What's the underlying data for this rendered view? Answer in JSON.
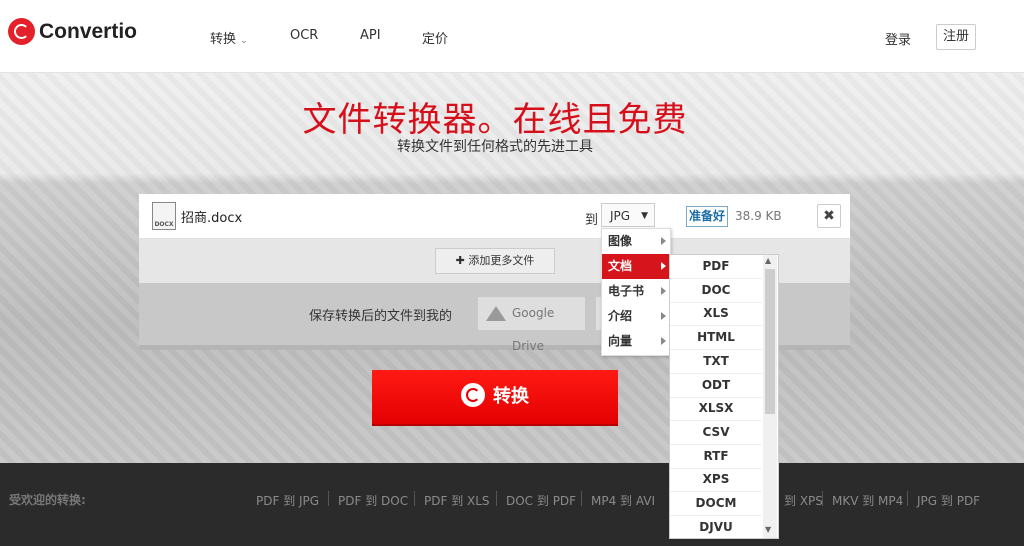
{
  "header": {
    "logo_text": "Convertio",
    "nav": [
      "转换",
      "OCR",
      "API",
      "定价"
    ],
    "login": "登录",
    "register": "注册"
  },
  "hero": {
    "title": "文件转换器。在线且免费",
    "subtitle": "转换文件到任何格式的先进工具"
  },
  "file": {
    "icon_label": "DOCX",
    "name": "招商.docx",
    "to_label": "到",
    "selected_format": "JPG",
    "status": "准备好",
    "size": "38.9 KB",
    "remove_glyph": "✖"
  },
  "add_more": "添加更多文件",
  "save": {
    "label": "保存转换后的文件到我的",
    "google_drive": "Google Drive"
  },
  "convert_button": "转换",
  "footer": {
    "label": "受欢迎的转换:",
    "links": [
      "PDF 到 JPG",
      "PDF 到 DOC",
      "PDF 到 XLS",
      "DOC 到 PDF",
      "MP4 到 AVI",
      "到 XPS",
      "MKV 到 MP4",
      "JPG 到 PDF"
    ]
  },
  "category_menu": {
    "items": [
      "图像",
      "文档",
      "电子书",
      "介绍",
      "向量"
    ],
    "active": "文档"
  },
  "format_list": {
    "items": [
      "PDF",
      "DOC",
      "XLS",
      "HTML",
      "TXT",
      "ODT",
      "XLSX",
      "CSV",
      "RTF",
      "XPS",
      "DOCM",
      "DJVU"
    ]
  },
  "colors": {
    "brand": "#e4202a",
    "active_menu": "#d5141b",
    "ready": "#1c6da6"
  }
}
